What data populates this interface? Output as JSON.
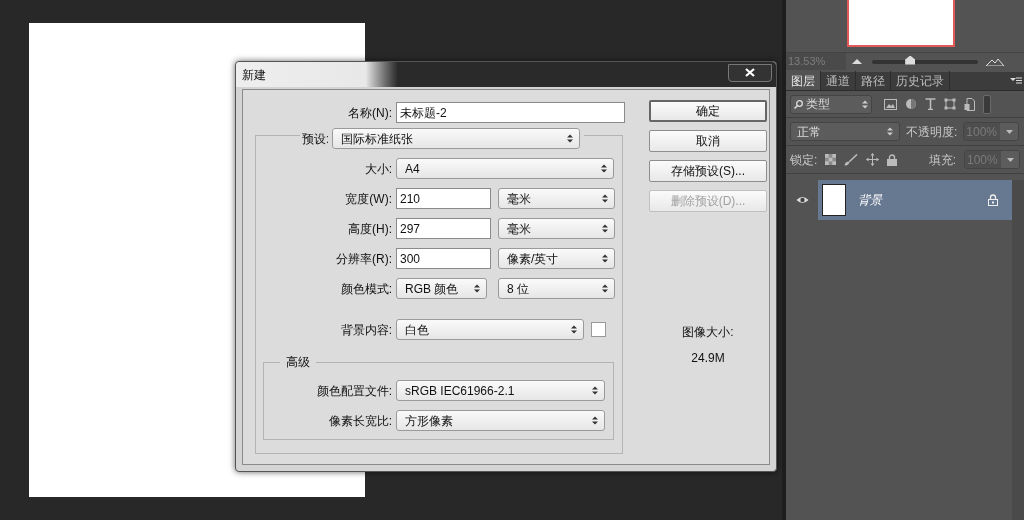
{
  "dialog": {
    "title": "新建",
    "name_field": {
      "label": "名称(N):",
      "value": "未标题-2"
    },
    "preset": {
      "label": "预设:",
      "value": "国际标准纸张"
    },
    "preset_fields": [
      {
        "kind": "select",
        "label": "大小:",
        "value": "A4"
      },
      {
        "kind": "input_unit",
        "label": "宽度(W):",
        "value": "210",
        "unit": "毫米"
      },
      {
        "kind": "input_unit",
        "label": "高度(H):",
        "value": "297",
        "unit": "毫米"
      },
      {
        "kind": "input_unit",
        "label": "分辨率(R):",
        "value": "300",
        "unit": "像素/英寸"
      },
      {
        "kind": "select_pair",
        "label": "颜色模式:",
        "value": "RGB 颜色",
        "unit": "8 位"
      },
      {
        "kind": "select_swatch",
        "label": "背景内容:",
        "value": "白色"
      }
    ],
    "advanced": {
      "title": "高级",
      "fields": [
        {
          "label": "颜色配置文件:",
          "value": "sRGB IEC61966-2.1"
        },
        {
          "label": "像素长宽比:",
          "value": "方形像素"
        }
      ]
    },
    "buttons": [
      {
        "label": "确定",
        "default": true,
        "disabled": false
      },
      {
        "label": "取消",
        "default": false,
        "disabled": false
      },
      {
        "label": "存储预设(S)...",
        "default": false,
        "disabled": false
      },
      {
        "label": "删除预设(D)...",
        "default": false,
        "disabled": true
      }
    ],
    "image_size": {
      "label": "图像大小:",
      "value": "24.9M"
    }
  },
  "panel": {
    "zoom": "13.53%",
    "zoom_slider": {
      "level": 0.36
    },
    "tabs": [
      {
        "label": "图层",
        "selected": true
      },
      {
        "label": "通道",
        "selected": false
      },
      {
        "label": "路径",
        "selected": false
      },
      {
        "label": "历史记录",
        "selected": false
      }
    ],
    "filter": {
      "value": "类型"
    },
    "blend_mode": {
      "value": "正常"
    },
    "opacity": {
      "label": "不透明度:",
      "value": "100%"
    },
    "lock": {
      "label": "锁定:"
    },
    "fill": {
      "label": "填充:",
      "value": "100%"
    },
    "layers": [
      {
        "name": "背景",
        "selected": true,
        "locked": true
      }
    ]
  }
}
